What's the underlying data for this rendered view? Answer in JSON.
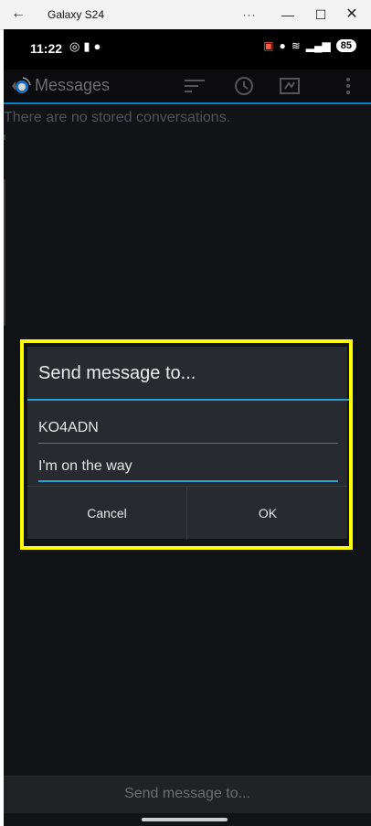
{
  "window": {
    "title": "Galaxy S24",
    "back_glyph": "←",
    "more_glyph": "···",
    "minimize_glyph": "—",
    "maximize_glyph": "☐",
    "close_glyph": "✕"
  },
  "status_bar": {
    "time": "11:22",
    "battery": "85"
  },
  "action_bar": {
    "title": "Messages"
  },
  "content": {
    "empty_message": "There are no stored conversations."
  },
  "dialog": {
    "title": "Send message to...",
    "recipient_value": "KO4ADN",
    "message_value": "I'm on the way",
    "cancel_label": "Cancel",
    "ok_label": "OK",
    "highlight_color": "#ffff00"
  },
  "bottom": {
    "send_label": "Send message to..."
  }
}
